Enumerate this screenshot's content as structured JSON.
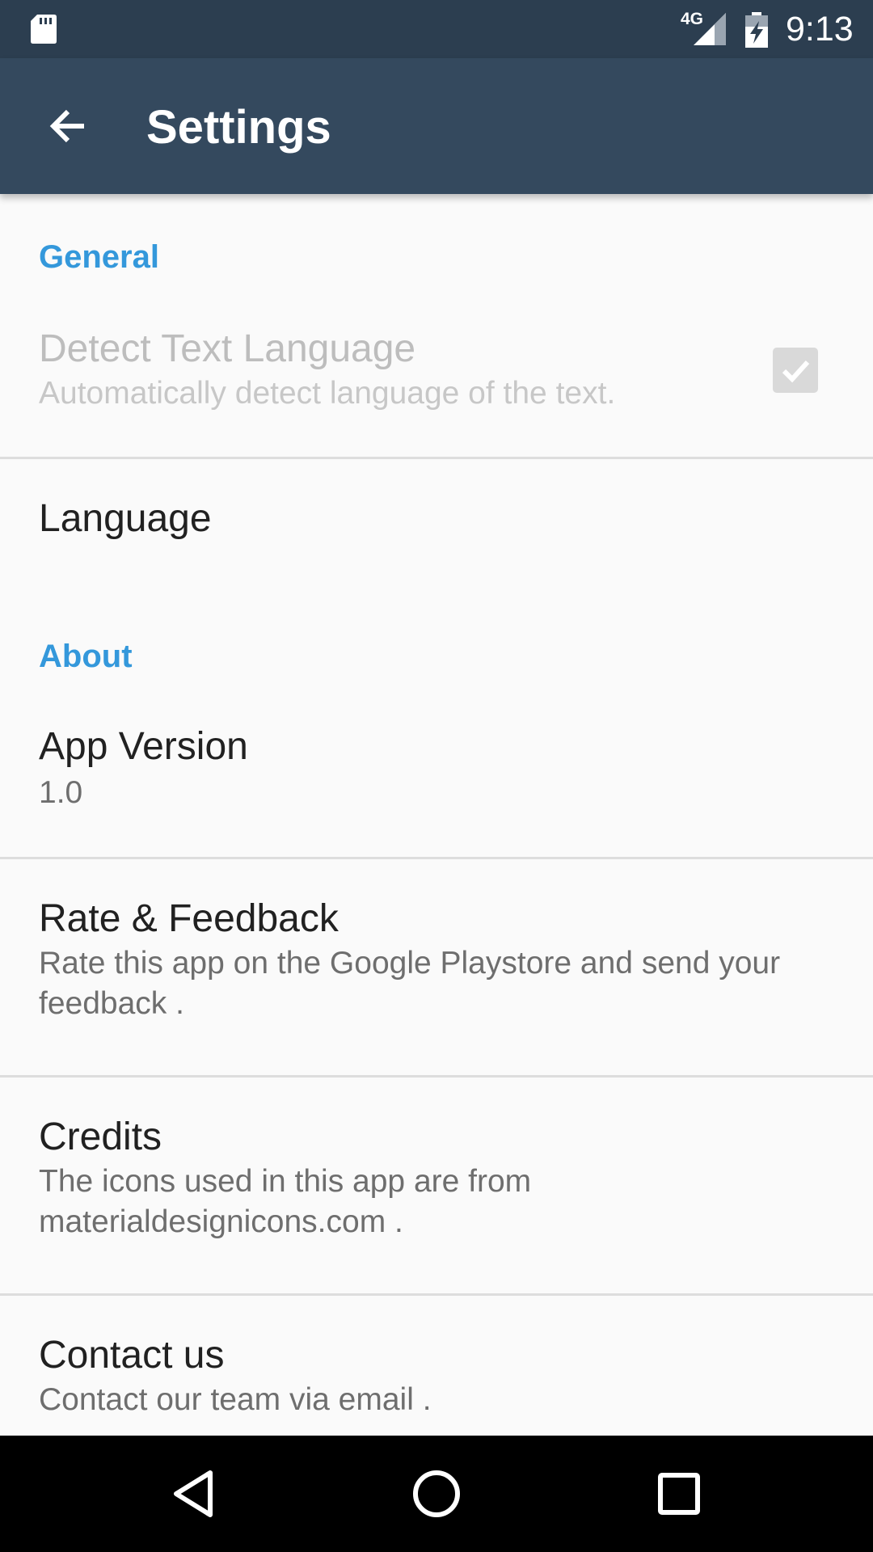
{
  "status_bar": {
    "network": "4G",
    "time": "9:13",
    "icons": [
      "sd-card-icon",
      "signal-icon",
      "battery-charging-icon"
    ]
  },
  "app_bar": {
    "title": "Settings",
    "back_icon": "arrow-left-icon"
  },
  "sections": {
    "general": {
      "header": "General",
      "detect_language": {
        "title": "Detect Text Language",
        "summary": "Automatically detect language of the text.",
        "checked": true,
        "enabled": false
      },
      "language": {
        "title": "Language"
      }
    },
    "about": {
      "header": "About",
      "app_version": {
        "title": "App Version",
        "summary": "1.0"
      },
      "rate_feedback": {
        "title": "Rate & Feedback",
        "summary": "Rate this app on the Google Playstore and send your feedback ."
      },
      "credits": {
        "title": "Credits",
        "summary": "The icons used in this app are from materialdesignicons.com ."
      },
      "contact": {
        "title": "Contact us",
        "summary": "Contact our team via email ."
      }
    }
  },
  "nav_bar": {
    "icons": [
      "back-triangle-icon",
      "home-circle-icon",
      "recents-square-icon"
    ]
  },
  "colors": {
    "status_bar": "#2c3e50",
    "app_bar": "#34495e",
    "accent": "#3498db",
    "background": "#fafafa"
  }
}
